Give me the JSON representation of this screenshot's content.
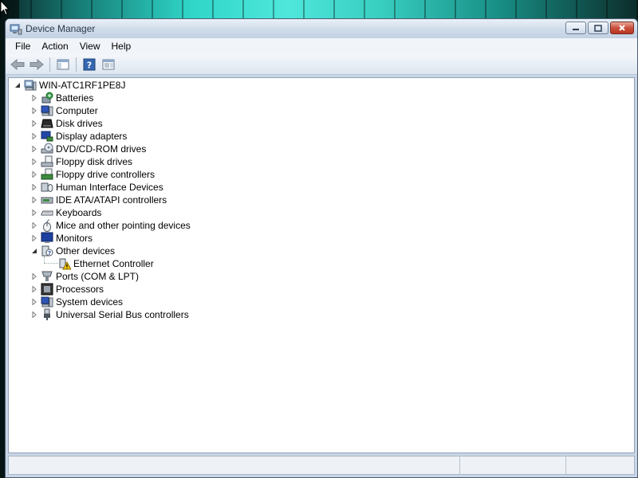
{
  "window": {
    "title": "Device Manager",
    "title_icon": "device-manager-icon"
  },
  "menu": [
    {
      "label": "File"
    },
    {
      "label": "Action"
    },
    {
      "label": "View"
    },
    {
      "label": "Help"
    }
  ],
  "toolbar": {
    "buttons": [
      "back-arrow-icon",
      "forward-arrow-icon",
      "show-hide-console-tree-icon",
      "help-icon",
      "properties-icon"
    ]
  },
  "tree": {
    "root": {
      "label": "WIN-ATC1RF1PE8J",
      "icon": "computer-icon",
      "expanded": true
    },
    "categories": [
      {
        "label": "Batteries",
        "icon": "battery-icon"
      },
      {
        "label": "Computer",
        "icon": "computer-icon"
      },
      {
        "label": "Disk drives",
        "icon": "disk-drive-icon"
      },
      {
        "label": "Display adapters",
        "icon": "display-adapter-icon"
      },
      {
        "label": "DVD/CD-ROM drives",
        "icon": "dvd-drive-icon"
      },
      {
        "label": "Floppy disk drives",
        "icon": "floppy-disk-icon"
      },
      {
        "label": "Floppy drive controllers",
        "icon": "floppy-controller-icon"
      },
      {
        "label": "Human Interface Devices",
        "icon": "hid-icon"
      },
      {
        "label": "IDE ATA/ATAPI controllers",
        "icon": "ide-controller-icon"
      },
      {
        "label": "Keyboards",
        "icon": "keyboard-icon"
      },
      {
        "label": "Mice and other pointing devices",
        "icon": "mouse-icon"
      },
      {
        "label": "Monitors",
        "icon": "monitor-icon"
      },
      {
        "label": "Other devices",
        "icon": "unknown-device-icon",
        "expanded": true,
        "children": [
          {
            "label": "Ethernet Controller",
            "icon": "warning-device-icon"
          }
        ]
      },
      {
        "label": "Ports (COM & LPT)",
        "icon": "port-icon"
      },
      {
        "label": "Processors",
        "icon": "processor-icon"
      },
      {
        "label": "System devices",
        "icon": "system-device-icon"
      },
      {
        "label": "Universal Serial Bus controllers",
        "icon": "usb-icon"
      }
    ]
  },
  "colors": {
    "accent": "#3a6ea5",
    "warning": "#f2c200"
  }
}
